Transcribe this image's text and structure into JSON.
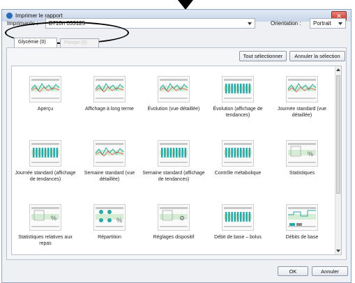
{
  "window": {
    "title": "Imprimer le rapport",
    "close_glyph": "✕"
  },
  "printer": {
    "label": "Imprimante :",
    "value": "B710n 033125"
  },
  "orientation": {
    "label": "Orientation :",
    "value": "Portrait"
  },
  "tabs": [
    {
      "label": "Glycémie (0)"
    },
    {
      "label": "Pompe (0)"
    }
  ],
  "buttons": {
    "select_all": "Tout sélectionner",
    "cancel_selection": "Annuler la sélection",
    "ok": "OK",
    "cancel": "Annuler"
  },
  "reports": [
    {
      "caption": "Aperçu",
      "icon": "overview-report-icon"
    },
    {
      "caption": "Affichage à long terme",
      "icon": "long-term-report-icon"
    },
    {
      "caption": "Évolution (vue détaillée)",
      "icon": "trend-detail-report-icon"
    },
    {
      "caption": "Évolution (affichage de tendances)",
      "icon": "trend-tendencies-report-icon"
    },
    {
      "caption": "Journée standard (vue détaillée)",
      "icon": "standard-day-detail-report-icon"
    },
    {
      "caption": "Journée standard (affichage de tendances)",
      "icon": "standard-day-trend-report-icon"
    },
    {
      "caption": "Semaine standard (vue détaillée)",
      "icon": "standard-week-detail-report-icon"
    },
    {
      "caption": "Semaine standard (affichage de tendances)",
      "icon": "standard-week-trend-report-icon"
    },
    {
      "caption": "Contrôle métabolique",
      "icon": "metabolic-control-report-icon"
    },
    {
      "caption": "Statistiques",
      "icon": "statistics-report-icon"
    },
    {
      "caption": "Statistiques relatives aux repas",
      "icon": "meal-statistics-report-icon"
    },
    {
      "caption": "Répartition",
      "icon": "distribution-report-icon"
    },
    {
      "caption": "Réglages dispositif",
      "icon": "device-settings-report-icon"
    },
    {
      "caption": "Débit de base – bolus",
      "icon": "basal-bolus-report-icon"
    },
    {
      "caption": "Débits de base",
      "icon": "basal-rates-report-icon"
    }
  ],
  "colors": {
    "titlebar": "#c9d7ea",
    "close": "#c2382b",
    "teal": "#2aa8a8",
    "green": "#7ac07a",
    "accent_red": "#d9443a",
    "blue": "#2b6bb5"
  }
}
